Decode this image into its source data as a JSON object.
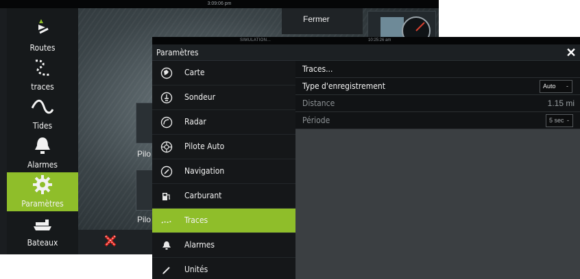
{
  "background": {
    "clock": "3:09:06 pm",
    "close_label": "Fermer",
    "sidebar": [
      {
        "label": "Routes",
        "icon": "routes-icon"
      },
      {
        "label": "traces",
        "icon": "traces-icon"
      },
      {
        "label": "Tides",
        "icon": "tides-icon"
      },
      {
        "label": "Alarmes",
        "icon": "bell-icon"
      },
      {
        "label": "Paramètres",
        "icon": "gear-icon",
        "active": true
      },
      {
        "label": "Bateaux",
        "icon": "vessels-icon"
      }
    ],
    "tile_labels": [
      "Pilo",
      "Pilo"
    ]
  },
  "settings": {
    "status_left": "SIMULATION...",
    "status_time": "10:25:26 am",
    "title": "Paramètres",
    "close_symbol": "✕",
    "menu": [
      {
        "label": "Carte",
        "icon": "chart-globe-icon"
      },
      {
        "label": "Sondeur",
        "icon": "sonar-icon"
      },
      {
        "label": "Radar",
        "icon": "radar-icon"
      },
      {
        "label": "Pilote Auto",
        "icon": "autopilot-wheel-icon"
      },
      {
        "label": "Navigation",
        "icon": "compass-icon"
      },
      {
        "label": "Carburant",
        "icon": "fuel-pump-icon"
      },
      {
        "label": "Traces",
        "icon": "track-icon",
        "selected": true
      },
      {
        "label": "Alarmes",
        "icon": "bell-icon"
      },
      {
        "label": "Unités",
        "icon": "pen-icon"
      }
    ],
    "rows": {
      "traces_label": "Traces...",
      "type_label": "Type d'enregistrement",
      "type_value": "Auto",
      "distance_label": "Distance",
      "distance_value": "1.15 mi",
      "periode_label": "Période",
      "periode_value": "5 sec"
    },
    "accent_color": "#8fbe2a"
  }
}
